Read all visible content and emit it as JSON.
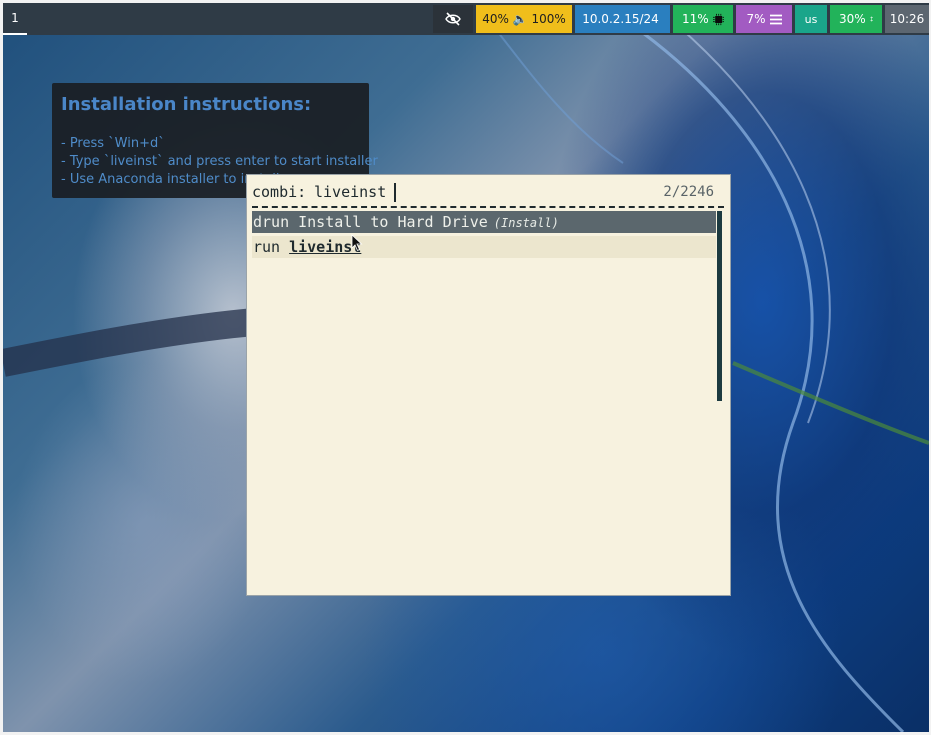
{
  "topbar": {
    "workspace": "1",
    "volume_text": "40% 🔈 100%",
    "network_text": "10.0.2.15/24",
    "cpu_text": "11%",
    "memory_text": "7%",
    "keyboard_layout": "us",
    "disk_text": "30%",
    "clock": "10:26",
    "icons": [
      "eye-slash-icon",
      "speaker-icon",
      "network-icon",
      "cpu-chip-icon",
      "memory-bars-icon",
      "disk-icon"
    ],
    "colors": {
      "bar_bg": "#2f3b46",
      "volume": "#f0be1b",
      "network": "#2a7fbf",
      "cpu": "#22b35a",
      "memory": "#a25bc2",
      "keyboard": "#1aa58a",
      "disk": "#22b35a",
      "clock": "#5c6670"
    }
  },
  "note": {
    "title": "Installation instructions:",
    "lines": [
      "- Press `Win+d`",
      "- Type `liveinst` and press enter to start installer",
      "- Use Anaconda installer to install"
    ]
  },
  "launcher": {
    "prompt": "combi:",
    "query": "liveinst",
    "counter": "2/2246",
    "entries": [
      {
        "mode": "drun",
        "name": "Install to Hard Drive",
        "hint": "(Install)",
        "selected": true
      },
      {
        "mode": "run",
        "name": "liveinst",
        "selected": false
      }
    ],
    "colors": {
      "background": "#f7f2df",
      "selected_row": "#5b676d",
      "alt_row": "#ece6ce"
    }
  }
}
